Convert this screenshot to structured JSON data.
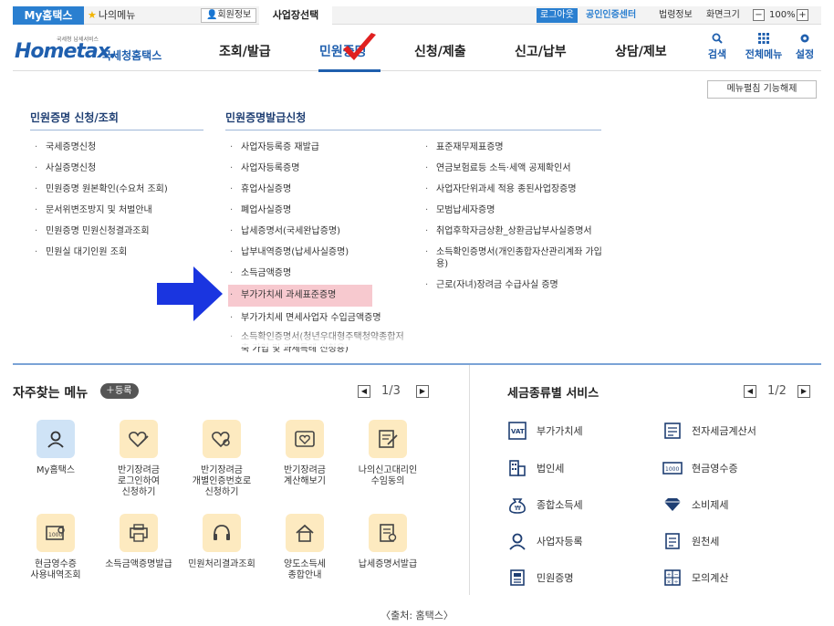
{
  "topbar": {
    "brand": "My홈택스",
    "my_menu": "나의메뉴",
    "member_info": "회원정보",
    "business_select": "사업장선택",
    "logout": "로그아웃",
    "public_cert": "공인인증센터",
    "law_info": "법령정보",
    "screen_size": "화면크기",
    "zoom_out": "−",
    "zoom": "100%",
    "zoom_in": "+"
  },
  "header": {
    "logo_small": "국세청 납세서비스",
    "logo_main": "Hometax.",
    "logo_kor": "국세청홈택스",
    "nav": [
      "조회/발급",
      "민원증명",
      "신청/제출",
      "신고/납부",
      "상담/제보"
    ],
    "active_nav": "민원증명",
    "tools": [
      {
        "label": "검색",
        "icon": "search-icon"
      },
      {
        "label": "전체메뉴",
        "icon": "grid-icon"
      },
      {
        "label": "설정",
        "icon": "gear-icon"
      }
    ]
  },
  "menu_toggle": "메뉴펼침 기능해제",
  "section1": {
    "title": "민원증명 신청/조회",
    "items": [
      "국세증명신청",
      "사실증명신청",
      "민원증명 원본확인(수요처 조회)",
      "문서위변조방지 및 처벌안내",
      "민원증명 민원신청결과조회",
      "민원실 대기인원 조회"
    ]
  },
  "section2": {
    "title": "민원증명발급신청",
    "col1": [
      "사업자등록증 재발급",
      "사업자등록증명",
      "휴업사실증명",
      "폐업사실증명",
      "납세증명서(국세완납증명)",
      "납부내역증명(납세사실증명)",
      "소득금액증명",
      "부가가치세 과세표준증명",
      "부가가치세 면세사업자 수입금액증명",
      "소득확인증명서(청년우대형주택청약종합저축 가입 및 과세특례 신청용)"
    ],
    "highlighted": "부가가치세 과세표준증명",
    "col2": [
      "표준재무제표증명",
      "연금보험료등 소득·세액 공제확인서",
      "사업자단위과세 적용 종된사업장증명",
      "모범납세자증명",
      "취업후학자금상환_상환금납부사실증명서",
      "소득확인증명서(개인종합자산관리계좌 가입용)",
      "근로(자녀)장려금 수급사실 증명"
    ]
  },
  "frequent": {
    "title": "자주찾는 메뉴",
    "register": "등록",
    "page": "1/3",
    "items": [
      {
        "label": "My홈택스",
        "icon": "user-icon"
      },
      {
        "label": "반기장려금\n로그인하여\n신청하기",
        "icon": "heart-pen-icon"
      },
      {
        "label": "반기장려금\n개별인증번호로\n신청하기",
        "icon": "heart-key-icon"
      },
      {
        "label": "반기장려금\n계산해보기",
        "icon": "calculator-heart-icon"
      },
      {
        "label": "나의신고대리인\n수임동의",
        "icon": "document-pen-icon"
      },
      {
        "label": "현금영수증\n사용내역조회",
        "icon": "receipt-search-icon"
      },
      {
        "label": "소득금액증명발급",
        "icon": "printer-icon"
      },
      {
        "label": "민원처리결과조회",
        "icon": "headset-icon"
      },
      {
        "label": "양도소득세\n종합안내",
        "icon": "house-icon"
      },
      {
        "label": "납세증명서발급",
        "icon": "document-print-icon"
      }
    ]
  },
  "tax_services": {
    "title": "세금종류별 서비스",
    "page": "1/2",
    "items": [
      {
        "label": "부가가치세",
        "icon": "vat-icon"
      },
      {
        "label": "전자세금계산서",
        "icon": "invoice-icon"
      },
      {
        "label": "법인세",
        "icon": "building-icon"
      },
      {
        "label": "현금영수증",
        "icon": "cash-receipt-icon"
      },
      {
        "label": "종합소득세",
        "icon": "money-bag-icon"
      },
      {
        "label": "소비제세",
        "icon": "diamond-icon"
      },
      {
        "label": "사업자등록",
        "icon": "user-icon"
      },
      {
        "label": "원천세",
        "icon": "tax-form-icon"
      },
      {
        "label": "민원증명",
        "icon": "certificate-icon"
      },
      {
        "label": "모의계산",
        "icon": "calculator-icon"
      }
    ]
  },
  "source": "〈출처: 홈택스〉"
}
